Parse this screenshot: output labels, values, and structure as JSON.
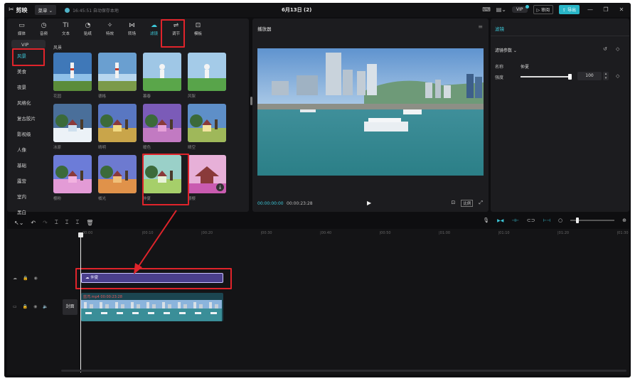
{
  "titlebar": {
    "app_name": "剪映",
    "menu_label": "菜单",
    "save_status": "16:45:51 自动保存本地",
    "project_title": "6月13日 (2)",
    "vip_label": "VIP",
    "review_label": "审阅",
    "export_label": "导出"
  },
  "tabs": [
    {
      "label": "媒体",
      "icon": "▭"
    },
    {
      "label": "音频",
      "icon": "◷"
    },
    {
      "label": "文本",
      "icon": "TI"
    },
    {
      "label": "贴纸",
      "icon": "◔"
    },
    {
      "label": "特效",
      "icon": "✧"
    },
    {
      "label": "转场",
      "icon": "⋈"
    },
    {
      "label": "滤镜",
      "icon": "☁"
    },
    {
      "label": "调节",
      "icon": "⇌"
    },
    {
      "label": "模板",
      "icon": "⊡"
    }
  ],
  "active_tab": "滤镜",
  "categories": [
    "VIP",
    "风景",
    "美食",
    "夜景",
    "风格化",
    "复古胶片",
    "影视级",
    "人像",
    "基础",
    "露营",
    "室内",
    "黑白"
  ],
  "active_category": "风景",
  "grid_title": "风景",
  "filters": [
    {
      "name": "花园"
    },
    {
      "name": "德格"
    },
    {
      "name": "暮春"
    },
    {
      "name": "风絮"
    },
    {
      "name": "冰原"
    },
    {
      "name": "晴明"
    },
    {
      "name": "暖色"
    },
    {
      "name": "晴空"
    },
    {
      "name": "樱粉"
    },
    {
      "name": "橘光"
    },
    {
      "name": "仲夏"
    },
    {
      "name": "樱樱"
    }
  ],
  "selected_filter": "仲夏",
  "player": {
    "title": "播放器",
    "current_time": "00:00:00:00",
    "total_time": "00:00:23:28",
    "ratio_label": "比例"
  },
  "properties": {
    "title": "滤镜",
    "section": "滤镜参数",
    "name_label": "名称",
    "name_value": "仲夏",
    "strength_label": "强度",
    "strength_value": "100",
    "strength_fraction": 1.0
  },
  "timeline": {
    "ticks": [
      "00:00",
      "|00:10",
      "|00:20",
      "|00:30",
      "|00:40",
      "|00:50",
      "|01:00",
      "|01:10",
      "|01:20",
      "|01:30"
    ],
    "filter_clip_label": "仲夏",
    "video_clip_label": "蓝湾.mp4  00:00:23:28",
    "cover_label": "封面"
  },
  "colors": {
    "accent": "#3cc7d8",
    "highlight": "#e0242b",
    "filter_clip": "#4a3f8c"
  }
}
